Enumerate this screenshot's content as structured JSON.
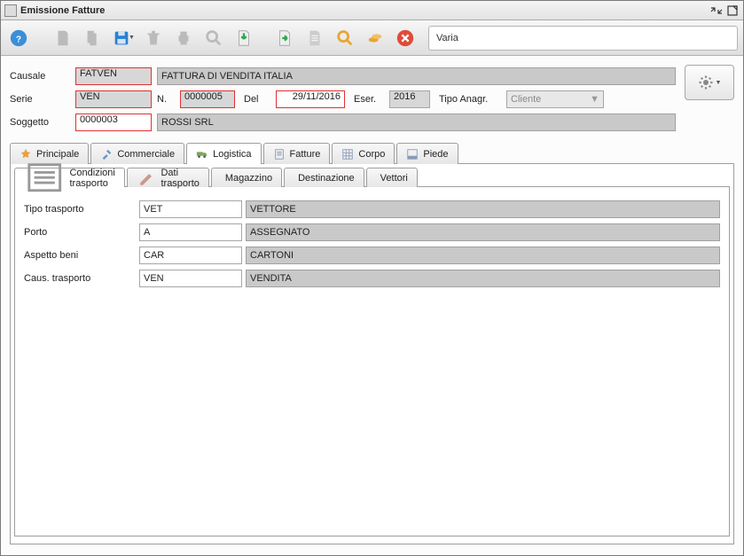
{
  "window": {
    "title": "Emissione Fatture"
  },
  "toolbar": {
    "status": "Varia"
  },
  "header": {
    "causale_label": "Causale",
    "causale_code": "FATVEN",
    "causale_desc": "FATTURA DI VENDITA ITALIA",
    "serie_label": "Serie",
    "serie_code": "VEN",
    "n_label": "N.",
    "n_value": "0000005",
    "del_label": "Del",
    "del_value": "29/11/2016",
    "eser_label": "Eser.",
    "eser_value": "2016",
    "tipoanagr_label": "Tipo Anagr.",
    "tipoanagr_value": "Cliente",
    "soggetto_label": "Soggetto",
    "soggetto_code": "0000003",
    "soggetto_desc": "ROSSI SRL"
  },
  "tabs": {
    "main": [
      "Principale",
      "Commerciale",
      "Logistica",
      "Fatture",
      "Corpo",
      "Piede"
    ],
    "main_active": 2,
    "sub": [
      "Condizioni trasporto",
      "Dati trasporto",
      "Magazzino",
      "Destinazione",
      "Vettori"
    ],
    "sub_active": 0
  },
  "condizioni": {
    "rows": [
      {
        "label": "Tipo trasporto",
        "code": "VET",
        "desc": "VETTORE"
      },
      {
        "label": "Porto",
        "code": "A",
        "desc": "ASSEGNATO"
      },
      {
        "label": "Aspetto beni",
        "code": "CAR",
        "desc": "CARTONI"
      },
      {
        "label": "Caus. trasporto",
        "code": "VEN",
        "desc": "VENDITA"
      }
    ]
  }
}
